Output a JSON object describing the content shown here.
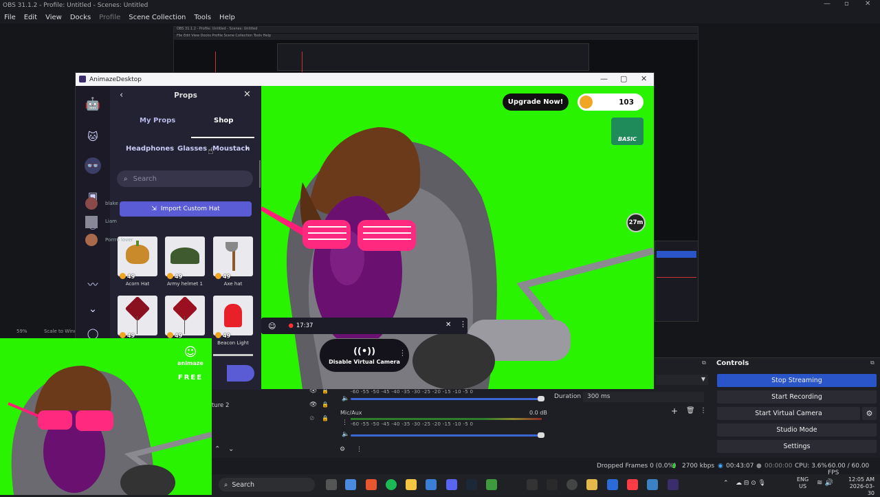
{
  "obs": {
    "title": "OBS 31.1.2 - Profile: Untitled - Scenes: Untitled",
    "menu": [
      "File",
      "Edit",
      "View",
      "Docks",
      "Profile",
      "Scene Collection",
      "Tools",
      "Help"
    ],
    "nested_title": "OBS 31.1.2 - Profile: Untitled - Scenes: Untitled",
    "nested_menu": "File  Edit  View  Docks  Profile  Scene Collection  Tools  Help",
    "zoom": "59%",
    "scale_label": "Scale to Wind"
  },
  "controls": {
    "title": "Controls",
    "stop_streaming": "Stop Streaming",
    "start_recording": "Start Recording",
    "start_virtual_camera": "Start Virtual Camera",
    "studio_mode": "Studio Mode",
    "settings": "Settings"
  },
  "transition": {
    "duration_label": "Duration",
    "duration_value": "300 ms"
  },
  "sources": {
    "item2": "ture 2"
  },
  "mixer": {
    "scale": "-60  -55  -50  -45  -40  -35  -30  -25  -20  -15  -10  -5  0",
    "mic_label": "Mic/Aux",
    "mic_db": "0.0 dB"
  },
  "status": {
    "dropped": "Dropped Frames 0 (0.0%)",
    "kbps": "2700 kbps",
    "stream_time": "00:43:07",
    "rec_time": "00:00:00",
    "cpu": "CPU: 3.6%",
    "fps": "60.00 / 60.00 FPS"
  },
  "taskbar": {
    "search": "Search",
    "lang1": "ENG",
    "lang2": "US",
    "time": "12:05 AM",
    "date": "2026-03-30"
  },
  "animaze": {
    "title": "AnimazeDesktop",
    "props_title": "Props",
    "tabs": [
      "My Props",
      "Shop"
    ],
    "categories": [
      "Headphones",
      "Glasses",
      "Moustach"
    ],
    "search_placeholder": "Search",
    "import_button": "Import Custom Hat",
    "upgrade": "Upgrade Now!",
    "coins": "103",
    "badge": "BASIC",
    "timer": "27m",
    "rec_time": "17:37",
    "vcam_label": "Disable Virtual Camera",
    "overlay_logo": "animaze",
    "overlay_free": "FREE",
    "props": [
      {
        "name": "Acorn Hat",
        "price": "49"
      },
      {
        "name": "Army helmet 1",
        "price": "49"
      },
      {
        "name": "Axe hat",
        "price": "49"
      },
      {
        "name": "",
        "price": "49"
      },
      {
        "name": "",
        "price": "49"
      },
      {
        "name": "Beacon Light",
        "price": "49"
      }
    ]
  },
  "chat": [
    "blake",
    "Liam",
    "Porrro lover"
  ],
  "colors": {
    "green_screen": "#2af300",
    "accent": "#5a5cd6",
    "obs_active": "#2a55c8",
    "coin": "#f0a523"
  }
}
